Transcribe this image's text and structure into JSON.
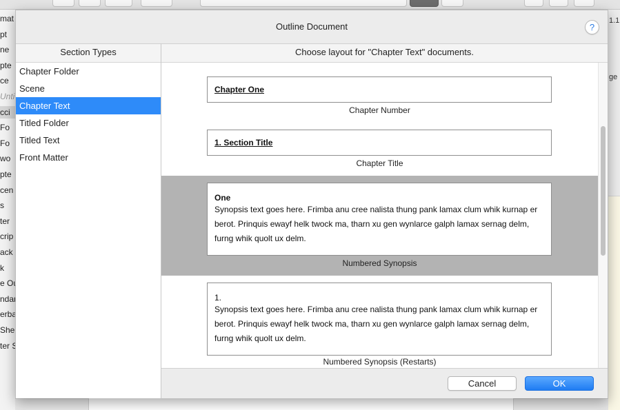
{
  "dialog": {
    "title": "Outline Document",
    "help_label": "?"
  },
  "section_types": {
    "header": "Section Types",
    "items": [
      {
        "label": "Chapter Folder",
        "selected": false
      },
      {
        "label": "Scene",
        "selected": false
      },
      {
        "label": "Chapter Text",
        "selected": true
      },
      {
        "label": "Titled Folder",
        "selected": false
      },
      {
        "label": "Titled Text",
        "selected": false
      },
      {
        "label": "Front Matter",
        "selected": false
      }
    ]
  },
  "layouts": {
    "header": "Choose layout for \"Chapter Text\" documents.",
    "options": [
      {
        "label": "Chapter Number",
        "preview_title": "Chapter One",
        "selected": false
      },
      {
        "label": "Chapter Title",
        "preview_title": "1. Section Title",
        "selected": false
      },
      {
        "label": "Numbered Synopsis",
        "preview_title": "One",
        "preview_lines": [
          "Synopsis text goes here. Frimba anu cree nalista thung pank lamax clum whik kurnap er",
          "berot. Prinquis ewayf helk twock ma, tharn xu gen wynlarce galph lamax sernag delm,",
          "furng whik quolt ux delm."
        ],
        "selected": true
      },
      {
        "label": "Numbered Synopsis (Restarts)",
        "preview_title": "1.",
        "preview_lines": [
          "Synopsis text goes here. Frimba anu cree nalista thung pank lamax clum whik kurnap er",
          "berot. Prinquis ewayf helk twock ma, tharn xu gen wynlarce galph lamax sernag delm,",
          "furng whik quolt ux delm."
        ],
        "selected": false
      }
    ]
  },
  "footer": {
    "cancel_label": "Cancel",
    "ok_label": "OK"
  },
  "background": {
    "binder_fragments": [
      "mat",
      "pt",
      "ne",
      "pte",
      "ce",
      "Unti",
      "cci",
      "Fo",
      "Fo",
      "wo",
      "pte",
      "cen",
      "s",
      "ter",
      "crip",
      "ack",
      "k",
      "e Ou",
      "ndar",
      "erba",
      "She",
      "ter Sketch"
    ],
    "right_fragments": [
      "1.1",
      "ge"
    ]
  },
  "colors": {
    "selection_blue": "#2e8bf9",
    "selected_layout_gray": "#b3b3b3",
    "ok_button_blue": "#1f7cf2"
  }
}
